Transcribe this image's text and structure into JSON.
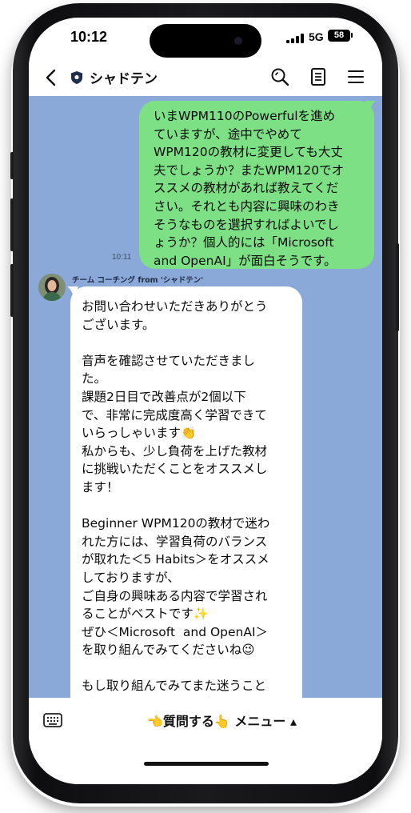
{
  "status_bar": {
    "time": "10:12",
    "network": "5G",
    "battery": "58"
  },
  "header": {
    "title": "シャドテン",
    "icons": [
      "back-icon",
      "shield-icon",
      "search-icon",
      "notes-icon",
      "menu-icon"
    ]
  },
  "chat": {
    "background_color": "#8aa9d8",
    "outgoing_bubble_color": "#7de085",
    "messages": [
      {
        "direction": "outgoing",
        "text": "いまWPM110のPowerfulを進め\nていますが、途中でやめて\nWPM120の教材に変更しても大丈\n夫でしょうか？またWPM120でオ\nススメの教材があれば教えてくだ\nさい。それとも内容に興味のわき\nそうなものを選択すればよいでし\nょうか？個人的には「Microsoft\nand OpenAI」が面白そうです。",
        "time": "10:11"
      },
      {
        "direction": "incoming",
        "sender": "チーム コーチング from 'シャドテン'",
        "text": "お問い合わせいただきありがとう\nございます。\n\n音声を確認させていただきまし\nた。\n課題2日目で改善点が2個以下\nで、非常に完成度高く学習できて\nいらっしゃいます👏\n私からも、少し負荷を上げた教材\nに挑戦いただくことをオススメし\nます！\n\nBeginner WPM120の教材で迷わ\nれた方には、学習負荷のバランス\nが取れた＜5 Habits＞をオススメ\nしておりますが、\nご自身の興味ある内容で学習され\nることがベストです✨\nぜひ＜Microsoft  and OpenAI＞\nを取り組んでみてくださいね😉\n\nもし取り組んでみてまた迷うこと\nがあれば、お気軽にご相談下さ\nい。"
      }
    ]
  },
  "bottom_bar": {
    "menu_label": "👈質問する👆 メニュー ▴",
    "icons": [
      "keyboard-icon"
    ]
  }
}
